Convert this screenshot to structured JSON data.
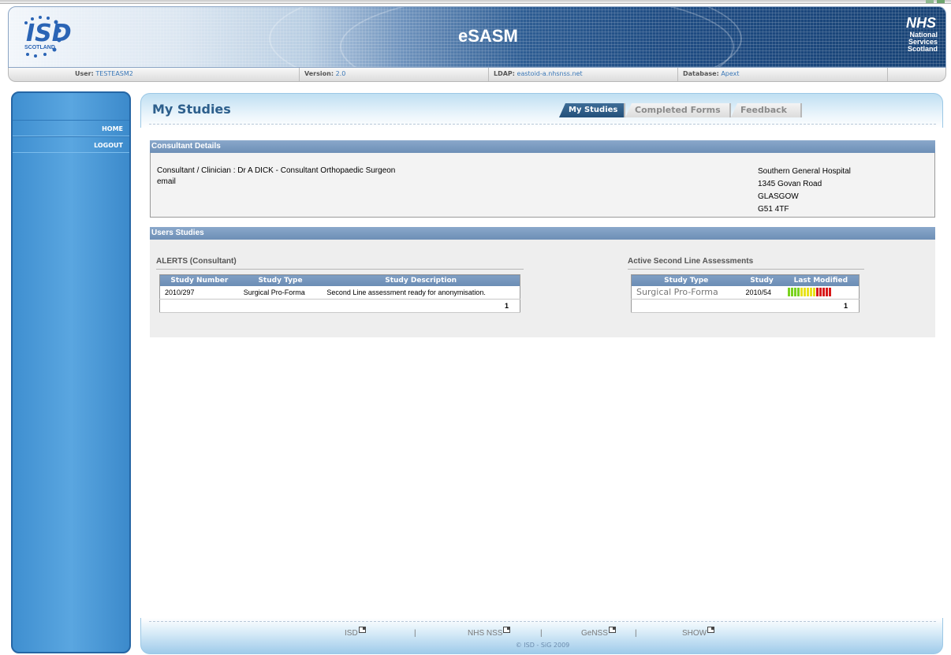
{
  "header": {
    "app_title": "eSASM",
    "isd_logo_text": "ISD",
    "isd_logo_sub": "SCOTLAND",
    "nhs_logo_title": "NHS",
    "nhs_logo_lines": [
      "National",
      "Services",
      "Scotland"
    ],
    "info": {
      "user_label": "User:",
      "user_value": "TESTEASM2",
      "version_label": "Version:",
      "version_value": "2.0",
      "ldap_label": "LDAP:",
      "ldap_value": "eastoid-a.nhsnss.net",
      "database_label": "Database:",
      "database_value": "Apext"
    }
  },
  "sidebar": {
    "items": [
      {
        "label": "HOME"
      },
      {
        "label": "LOGOUT"
      }
    ]
  },
  "page": {
    "title": "My Studies",
    "tabs": [
      {
        "label": "My Studies",
        "active": true
      },
      {
        "label": "Completed Forms",
        "active": false
      },
      {
        "label": "Feedback",
        "active": false
      }
    ]
  },
  "consultant": {
    "section_title": "Consultant Details",
    "line1": "Consultant / Clinician : Dr A DICK - Consultant Orthopaedic Surgeon",
    "line2": "email",
    "address": [
      "Southern General Hospital",
      "1345 Govan Road",
      "GLASGOW",
      "G51 4TF"
    ]
  },
  "studies": {
    "section_title": "Users Studies",
    "alerts": {
      "title": "ALERTS (Consultant)",
      "columns": [
        "Study Number",
        "Study Type",
        "Study Description"
      ],
      "rows": [
        {
          "study_number": "2010/297",
          "study_type": "Surgical Pro-Forma",
          "description": "Second Line assessment ready for anonymisation."
        }
      ],
      "count": "1"
    },
    "active": {
      "title": "Active Second Line Assessments",
      "columns": [
        "Study Type",
        "Study",
        "Last Modified"
      ],
      "rows": [
        {
          "study_type": "Surgical Pro-Forma",
          "study": "2010/54"
        }
      ],
      "count": "1",
      "progress_colors": [
        "#7ad21f",
        "#7ad21f",
        "#7ad21f",
        "#7ad21f",
        "#e8e21c",
        "#e8e21c",
        "#e8e21c",
        "#e8e21c",
        "#e8e21c",
        "#d81a1a",
        "#d81a1a",
        "#d81a1a",
        "#d81a1a",
        "#d81a1a"
      ]
    }
  },
  "footer": {
    "links": [
      "ISD",
      "NHS NSS",
      "GeNSS",
      "SHOW"
    ],
    "separator": "|",
    "copyright": "© ISD - SiG 2009"
  },
  "colors": {
    "accent": "#2d5f8c",
    "sidebar": "#4a98d6",
    "section_bar": "#7896bd"
  }
}
